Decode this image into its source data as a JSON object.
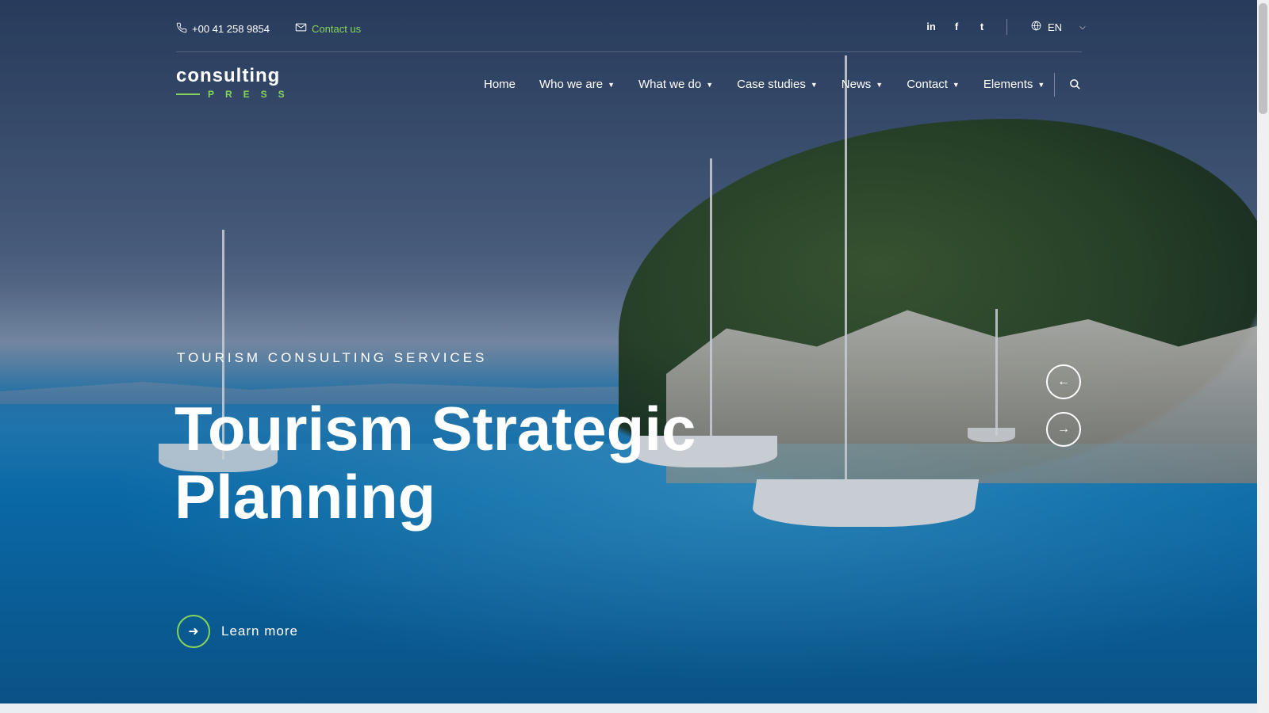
{
  "topbar": {
    "phone": "+00 41 258 9854",
    "contact_label": "Contact us",
    "socials": [
      "in",
      "f",
      "t"
    ],
    "language": "EN"
  },
  "logo": {
    "word": "consulting",
    "sub": "PRESS"
  },
  "nav": {
    "items": [
      "Home",
      "Who we are",
      "What we do",
      "Case studies",
      "News",
      "Contact",
      "Elements"
    ]
  },
  "hero": {
    "eyebrow": "TOURISM CONSULTING SERVICES",
    "headline_line1": "Tourism Strategic",
    "headline_line2": "Planning",
    "cta_label": "Learn more"
  },
  "colors": {
    "accent": "#86d55a"
  },
  "icons": {
    "phone": "phone-icon",
    "mail": "mail-icon",
    "globe": "globe-icon",
    "search": "search-icon",
    "arrow_left": "arrow-left-icon",
    "arrow_right": "arrow-right-icon"
  }
}
